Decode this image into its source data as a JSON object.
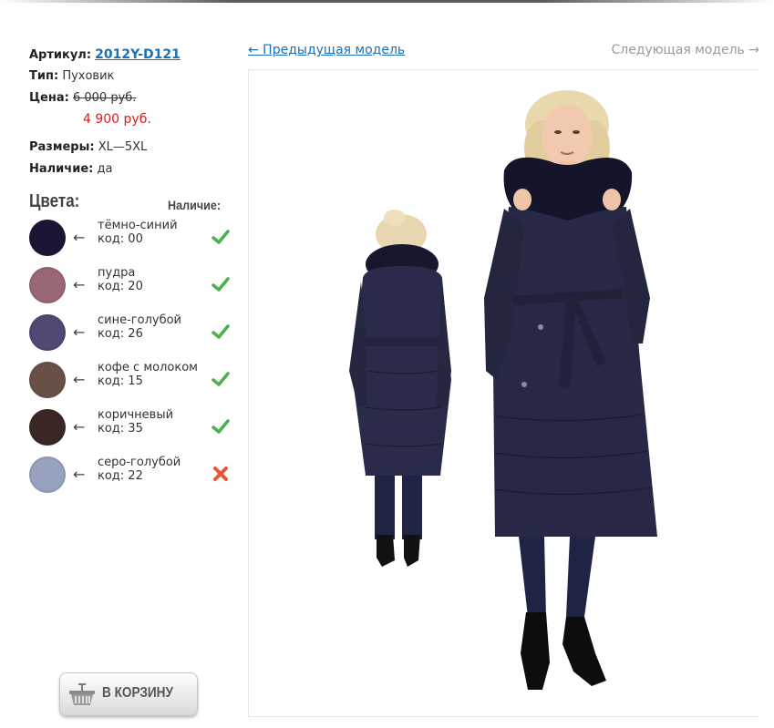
{
  "product": {
    "article_label": "Артикул:",
    "article_value": "2012Y-D121",
    "type_label": "Тип:",
    "type_value": "Пуховик",
    "price_label": "Цена:",
    "old_price": "6 000 руб.",
    "new_price": "4 900 руб.",
    "sizes_label": "Размеры:",
    "sizes_value": "XL—5XL",
    "stock_label": "Наличие:",
    "stock_value": "да"
  },
  "colors": {
    "title": "Цвета:",
    "availability_header": "Наличие:",
    "items": [
      {
        "name": "тёмно-синий",
        "code": "код: 00",
        "swatch": "#1e1535",
        "available": true
      },
      {
        "name": "пудра",
        "code": "код: 20",
        "swatch": "#9a6774",
        "available": true
      },
      {
        "name": "сине-голубой",
        "code": "код: 26",
        "swatch": "#524873",
        "available": true
      },
      {
        "name": "кофе с молоком",
        "code": "код: 15",
        "swatch": "#6a5148",
        "available": true
      },
      {
        "name": "коричневый",
        "code": "код: 35",
        "swatch": "#3a2726",
        "available": true
      },
      {
        "name": "серо-голубой",
        "code": "код: 22",
        "swatch": "#97a2be",
        "available": false
      }
    ],
    "arrow": "←"
  },
  "cart": {
    "label": "В КОРЗИНУ",
    "icon": "basket-icon"
  },
  "navigation": {
    "prev": "← Предыдущая модель",
    "next": "Следующая модель →"
  },
  "theme": {
    "link": "#1a6fb7",
    "sale": "#e21a1a",
    "check": "#4caf50",
    "cross": "#e8552e",
    "coat": "#272845"
  }
}
